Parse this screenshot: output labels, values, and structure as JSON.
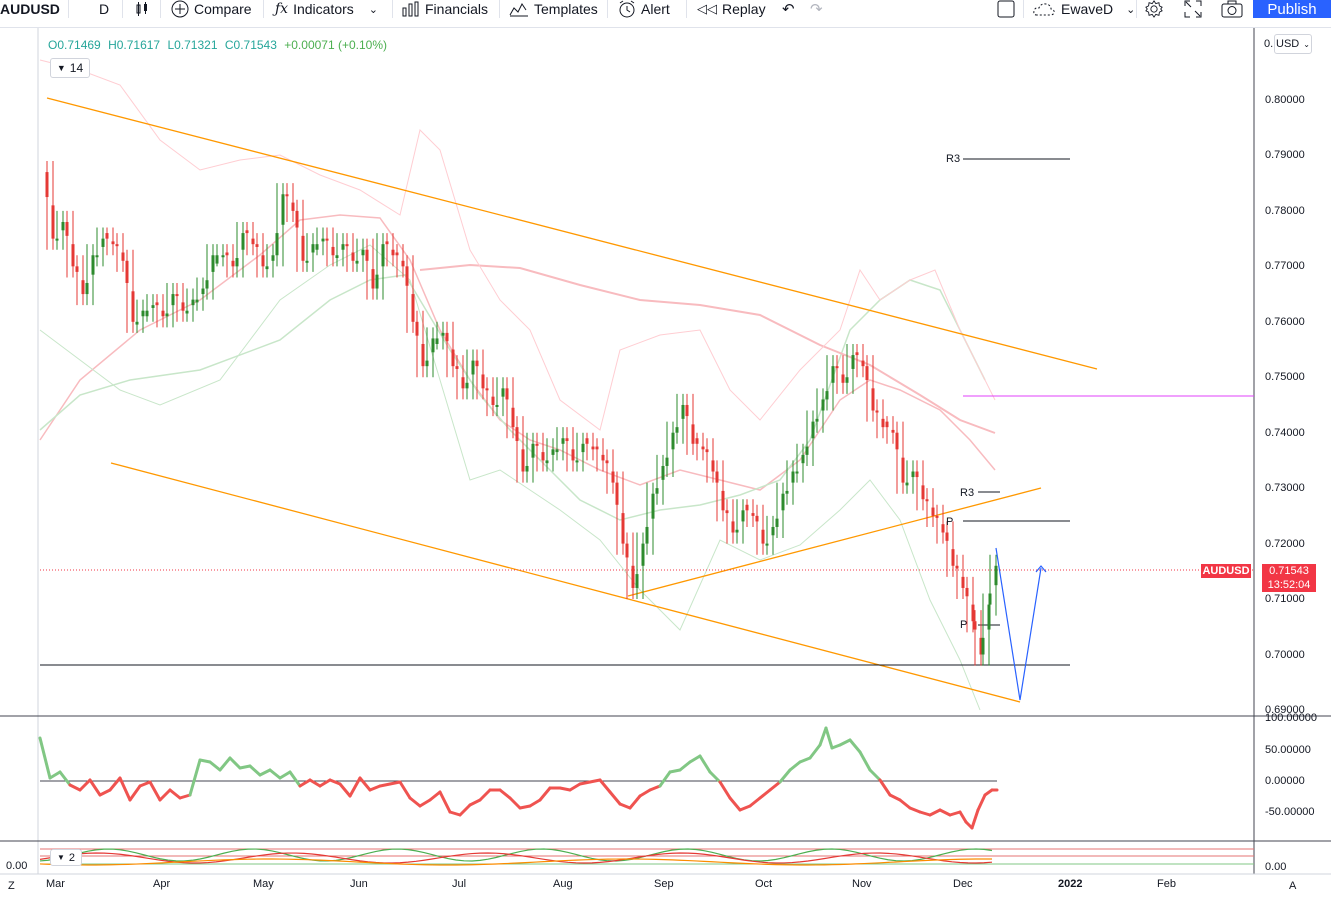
{
  "toolbar": {
    "symbol": "AUDUSD",
    "interval": "D",
    "compare": "Compare",
    "indicators": "Indicators",
    "financials": "Financials",
    "templates": "Templates",
    "alert": "Alert",
    "replay": "Replay",
    "layout_name": "EwaveD",
    "publish": "Publish"
  },
  "legend": {
    "open": "O0.71469",
    "high": "H0.71617",
    "low": "L0.71321",
    "close": "C0.71543",
    "change": "+0.00071 (+0.10%)",
    "collapse_count": "14"
  },
  "price_axis": {
    "currency": "USD",
    "ticks": [
      "0.80000",
      "0.79000",
      "0.78000",
      "0.77000",
      "0.76000",
      "0.75000",
      "0.74000",
      "0.73000",
      "0.72000",
      "0.71000",
      "0.70000",
      "0.69000"
    ],
    "top_partial": "0."
  },
  "last_price": {
    "symbol_tag": "AUDUSD",
    "price": "0.71543",
    "countdown": "13:52:04"
  },
  "oscillator": {
    "ticks": [
      "100.00000",
      "50.00000",
      "0.00000",
      "-50.00000"
    ]
  },
  "lower_pane": {
    "count": "2",
    "left_value": "0.00",
    "right_value": "0.00"
  },
  "time_axis": {
    "labels": [
      "Mar",
      "Apr",
      "May",
      "Jun",
      "Jul",
      "Aug",
      "Sep",
      "Oct",
      "Nov",
      "Dec",
      "2022",
      "Feb"
    ],
    "left_button": "Z",
    "right_button": "A"
  },
  "pivot_labels": {
    "r3_upper": "R3",
    "r3_lower": "R3",
    "p_upper": "P",
    "p_lower": "P"
  },
  "colors": {
    "up": "#26a69a",
    "up_candle": "#2e8b2e",
    "down": "#f23645",
    "accent": "#2962ff",
    "trendline": "#ff9800",
    "projection": "#2962ff",
    "magenta_level": "#e040fb"
  },
  "icons": [
    "candles-icon",
    "plus-circle-icon",
    "fx-icon",
    "financials-icon",
    "templates-icon",
    "alert-icon",
    "replay-icon",
    "undo-icon",
    "redo-icon",
    "layout-icon",
    "cloud-icon",
    "gear-icon",
    "fullscreen-icon",
    "camera-icon"
  ]
}
